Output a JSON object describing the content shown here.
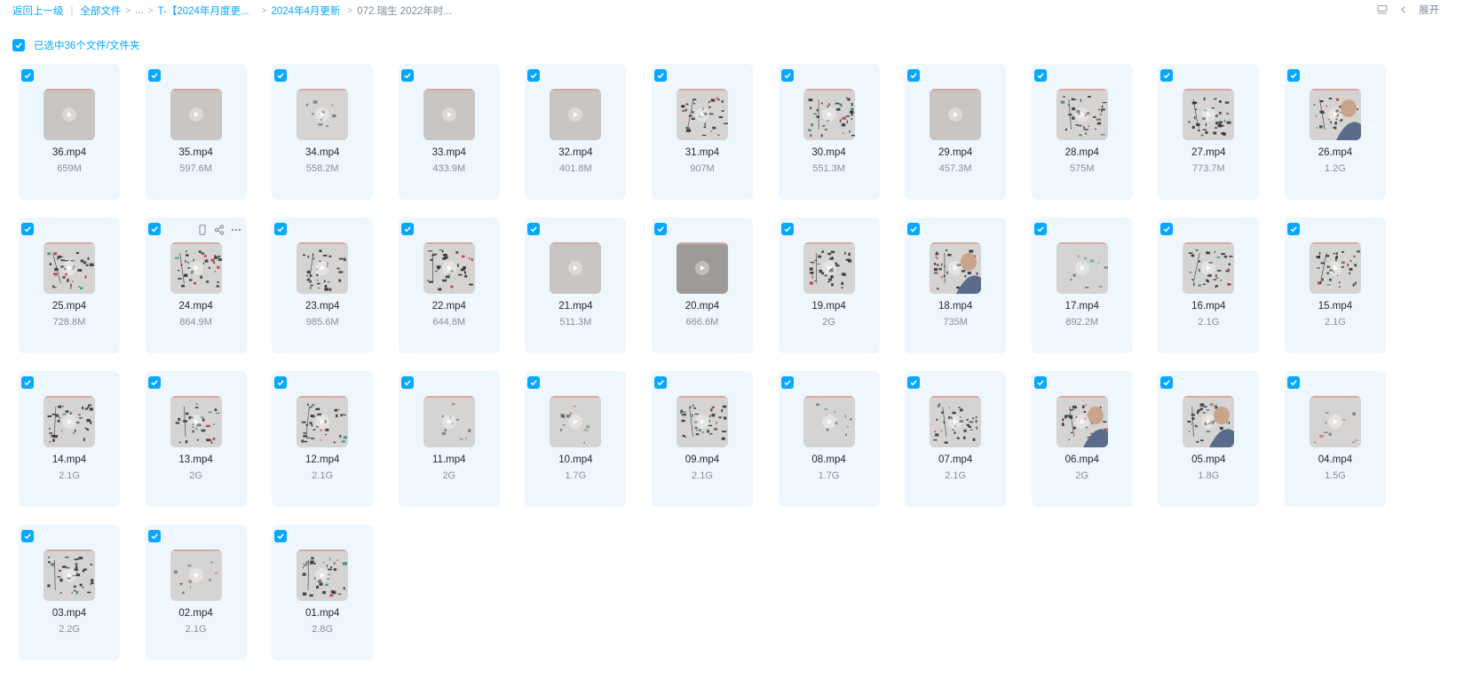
{
  "breadcrumb": {
    "back": "返回上一级",
    "all_files": "全部文件",
    "ellipsis": "...",
    "folder1": "T-【2024年月度更...",
    "folder2": "2024年4月更新",
    "current": "072.瑞生 2022年时..."
  },
  "toolbar": {
    "expand_label": "展开",
    "view_icon": "list-view-icon",
    "collapse_icon": "chevron-left-icon"
  },
  "selection": {
    "label": "已选中36个文件/文件夹"
  },
  "colors": {
    "accent": "#06a7ff",
    "card_bg": "#eef7fe"
  },
  "files": [
    {
      "name": "36.mp4",
      "size": "659M",
      "thumb": "blank"
    },
    {
      "name": "35.mp4",
      "size": "597.6M",
      "thumb": "blank"
    },
    {
      "name": "34.mp4",
      "size": "558.2M",
      "thumb": "faint"
    },
    {
      "name": "33.mp4",
      "size": "433.9M",
      "thumb": "blank"
    },
    {
      "name": "32.mp4",
      "size": "401.8M",
      "thumb": "blank"
    },
    {
      "name": "31.mp4",
      "size": "907M",
      "thumb": "writing"
    },
    {
      "name": "30.mp4",
      "size": "551.3M",
      "thumb": "writing"
    },
    {
      "name": "29.mp4",
      "size": "457.3M",
      "thumb": "blank"
    },
    {
      "name": "28.mp4",
      "size": "575M",
      "thumb": "writing"
    },
    {
      "name": "27.mp4",
      "size": "773.7M",
      "thumb": "writing"
    },
    {
      "name": "26.mp4",
      "size": "1.2G",
      "thumb": "person"
    },
    {
      "name": "25.mp4",
      "size": "728.8M",
      "thumb": "writing"
    },
    {
      "name": "24.mp4",
      "size": "864.9M",
      "thumb": "writing",
      "hover": true
    },
    {
      "name": "23.mp4",
      "size": "985.6M",
      "thumb": "writing"
    },
    {
      "name": "22.mp4",
      "size": "644.8M",
      "thumb": "writing"
    },
    {
      "name": "21.mp4",
      "size": "511.3M",
      "thumb": "blank"
    },
    {
      "name": "20.mp4",
      "size": "666.6M",
      "thumb": "dark"
    },
    {
      "name": "19.mp4",
      "size": "2G",
      "thumb": "writing"
    },
    {
      "name": "18.mp4",
      "size": "735M",
      "thumb": "person"
    },
    {
      "name": "17.mp4",
      "size": "892.2M",
      "thumb": "faint"
    },
    {
      "name": "16.mp4",
      "size": "2.1G",
      "thumb": "writing"
    },
    {
      "name": "15.mp4",
      "size": "2.1G",
      "thumb": "writing"
    },
    {
      "name": "14.mp4",
      "size": "2.1G",
      "thumb": "writing"
    },
    {
      "name": "13.mp4",
      "size": "2G",
      "thumb": "writing"
    },
    {
      "name": "12.mp4",
      "size": "2.1G",
      "thumb": "writing"
    },
    {
      "name": "11.mp4",
      "size": "2G",
      "thumb": "faint"
    },
    {
      "name": "10.mp4",
      "size": "1.7G",
      "thumb": "faint"
    },
    {
      "name": "09.mp4",
      "size": "2.1G",
      "thumb": "writing"
    },
    {
      "name": "08.mp4",
      "size": "1.7G",
      "thumb": "faint"
    },
    {
      "name": "07.mp4",
      "size": "2.1G",
      "thumb": "writing"
    },
    {
      "name": "06.mp4",
      "size": "2G",
      "thumb": "person"
    },
    {
      "name": "05.mp4",
      "size": "1.8G",
      "thumb": "person"
    },
    {
      "name": "04.mp4",
      "size": "1.5G",
      "thumb": "faint"
    },
    {
      "name": "03.mp4",
      "size": "2.2G",
      "thumb": "writing"
    },
    {
      "name": "02.mp4",
      "size": "2.1G",
      "thumb": "faint"
    },
    {
      "name": "01.mp4",
      "size": "2.8G",
      "thumb": "writing"
    }
  ]
}
